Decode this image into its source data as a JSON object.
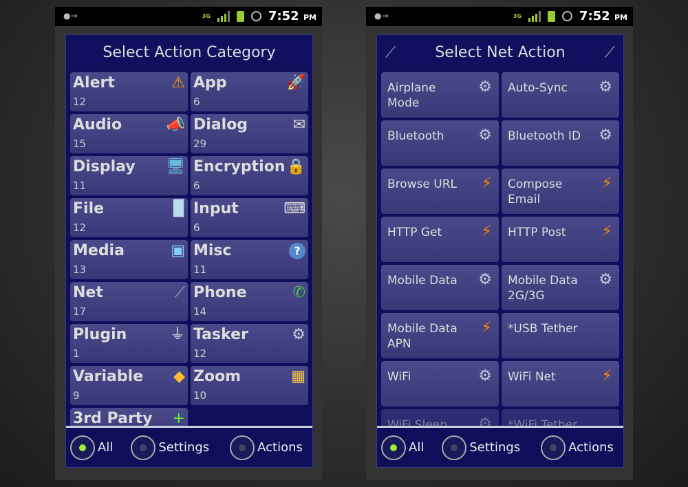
{
  "status": {
    "time": "7:52",
    "ampm": "PM",
    "network": "3G"
  },
  "left": {
    "title": "Select Action Category",
    "items": [
      {
        "label": "Alert",
        "count": "12",
        "icon": "warning-icon"
      },
      {
        "label": "App",
        "count": "6",
        "icon": "rocket-icon"
      },
      {
        "label": "Audio",
        "count": "15",
        "icon": "megaphone-icon"
      },
      {
        "label": "Dialog",
        "count": "29",
        "icon": "dialog-icon"
      },
      {
        "label": "Display",
        "count": "11",
        "icon": "monitor-icon"
      },
      {
        "label": "Encryption",
        "count": "6",
        "icon": "lock-icon"
      },
      {
        "label": "File",
        "count": "12",
        "icon": "file-icon"
      },
      {
        "label": "Input",
        "count": "6",
        "icon": "keyboard-icon"
      },
      {
        "label": "Media",
        "count": "13",
        "icon": "media-icon"
      },
      {
        "label": "Misc",
        "count": "11",
        "icon": "help-icon"
      },
      {
        "label": "Net",
        "count": "17",
        "icon": "cable-icon"
      },
      {
        "label": "Phone",
        "count": "14",
        "icon": "phone-icon"
      },
      {
        "label": "Plugin",
        "count": "1",
        "icon": "plug-icon"
      },
      {
        "label": "Tasker",
        "count": "12",
        "icon": "gear-icon"
      },
      {
        "label": "Variable",
        "count": "9",
        "icon": "tag-icon"
      },
      {
        "label": "Zoom",
        "count": "10",
        "icon": "zoom-widget-icon"
      },
      {
        "label": "3rd Party",
        "count": "",
        "icon": "plus-icon"
      }
    ]
  },
  "right": {
    "title": "Select Net Action",
    "items": [
      {
        "label": "Airplane Mode",
        "icon": "gear-icon"
      },
      {
        "label": "Auto-Sync",
        "icon": "gear-icon"
      },
      {
        "label": "Bluetooth",
        "icon": "gear-icon"
      },
      {
        "label": "Bluetooth ID",
        "icon": "gear-icon"
      },
      {
        "label": "Browse URL",
        "icon": "bolt-icon"
      },
      {
        "label": "Compose Email",
        "icon": "bolt-icon"
      },
      {
        "label": "HTTP Get",
        "icon": "bolt-icon"
      },
      {
        "label": "HTTP Post",
        "icon": "bolt-icon"
      },
      {
        "label": "Mobile Data",
        "icon": "gear-icon"
      },
      {
        "label": "Mobile Data 2G/3G",
        "icon": "gear-icon"
      },
      {
        "label": "Mobile Data APN",
        "icon": "bolt-icon"
      },
      {
        "label": "*USB Tether",
        "icon": ""
      },
      {
        "label": "WiFi",
        "icon": "gear-icon"
      },
      {
        "label": "WiFi Net",
        "icon": "bolt-icon"
      },
      {
        "label": "WiFi Sleep",
        "icon": "gear-icon"
      },
      {
        "label": "*WiFi Tether",
        "icon": ""
      }
    ]
  },
  "filters": [
    {
      "label": "All",
      "selected": true
    },
    {
      "label": "Settings",
      "selected": false
    },
    {
      "label": "Actions",
      "selected": false
    }
  ],
  "colors": {
    "dialog": "#0e0e5a",
    "cell": "#42427f",
    "selected": "#99ee33"
  }
}
